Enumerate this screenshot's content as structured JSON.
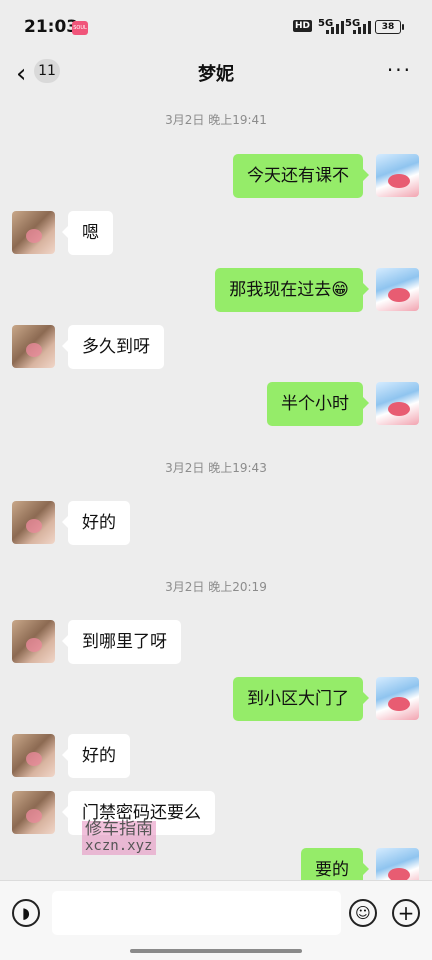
{
  "status_bar": {
    "time": "21:03",
    "app_badge": "SOUL",
    "hd": "HD",
    "net1": "5G",
    "net2": "5G",
    "battery": "38"
  },
  "header": {
    "back_icon": "chevron-left-icon",
    "unread_count": "11",
    "title": "梦妮",
    "more_icon": "more-icon"
  },
  "messages": [
    {
      "type": "timestamp",
      "text": "3月2日 晚上19:41"
    },
    {
      "type": "out",
      "text": "今天还有课不"
    },
    {
      "type": "in",
      "text": "嗯"
    },
    {
      "type": "out",
      "text": "那我现在过去",
      "emoji": "😁"
    },
    {
      "type": "in",
      "text": "多久到呀"
    },
    {
      "type": "out",
      "text": "半个小时"
    },
    {
      "type": "timestamp",
      "text": "3月2日 晚上19:43"
    },
    {
      "type": "in",
      "text": "好的"
    },
    {
      "type": "timestamp",
      "text": "3月2日 晚上20:19"
    },
    {
      "type": "in",
      "text": "到哪里了呀"
    },
    {
      "type": "out",
      "text": "到小区大门了"
    },
    {
      "type": "in",
      "text": "好的"
    },
    {
      "type": "in",
      "text": "门禁密码还要么"
    },
    {
      "type": "out",
      "text": "要的"
    }
  ],
  "watermark": {
    "line1": "修车指南",
    "line2": "xczn.xyz"
  },
  "input_bar": {
    "voice_icon": "voice-icon",
    "text_value": "",
    "emoji_icon": "smiley-icon",
    "add_icon": "plus-icon"
  },
  "colors": {
    "outgoing_bubble": "#95ec69",
    "incoming_bubble": "#ffffff",
    "background": "#ededed"
  }
}
